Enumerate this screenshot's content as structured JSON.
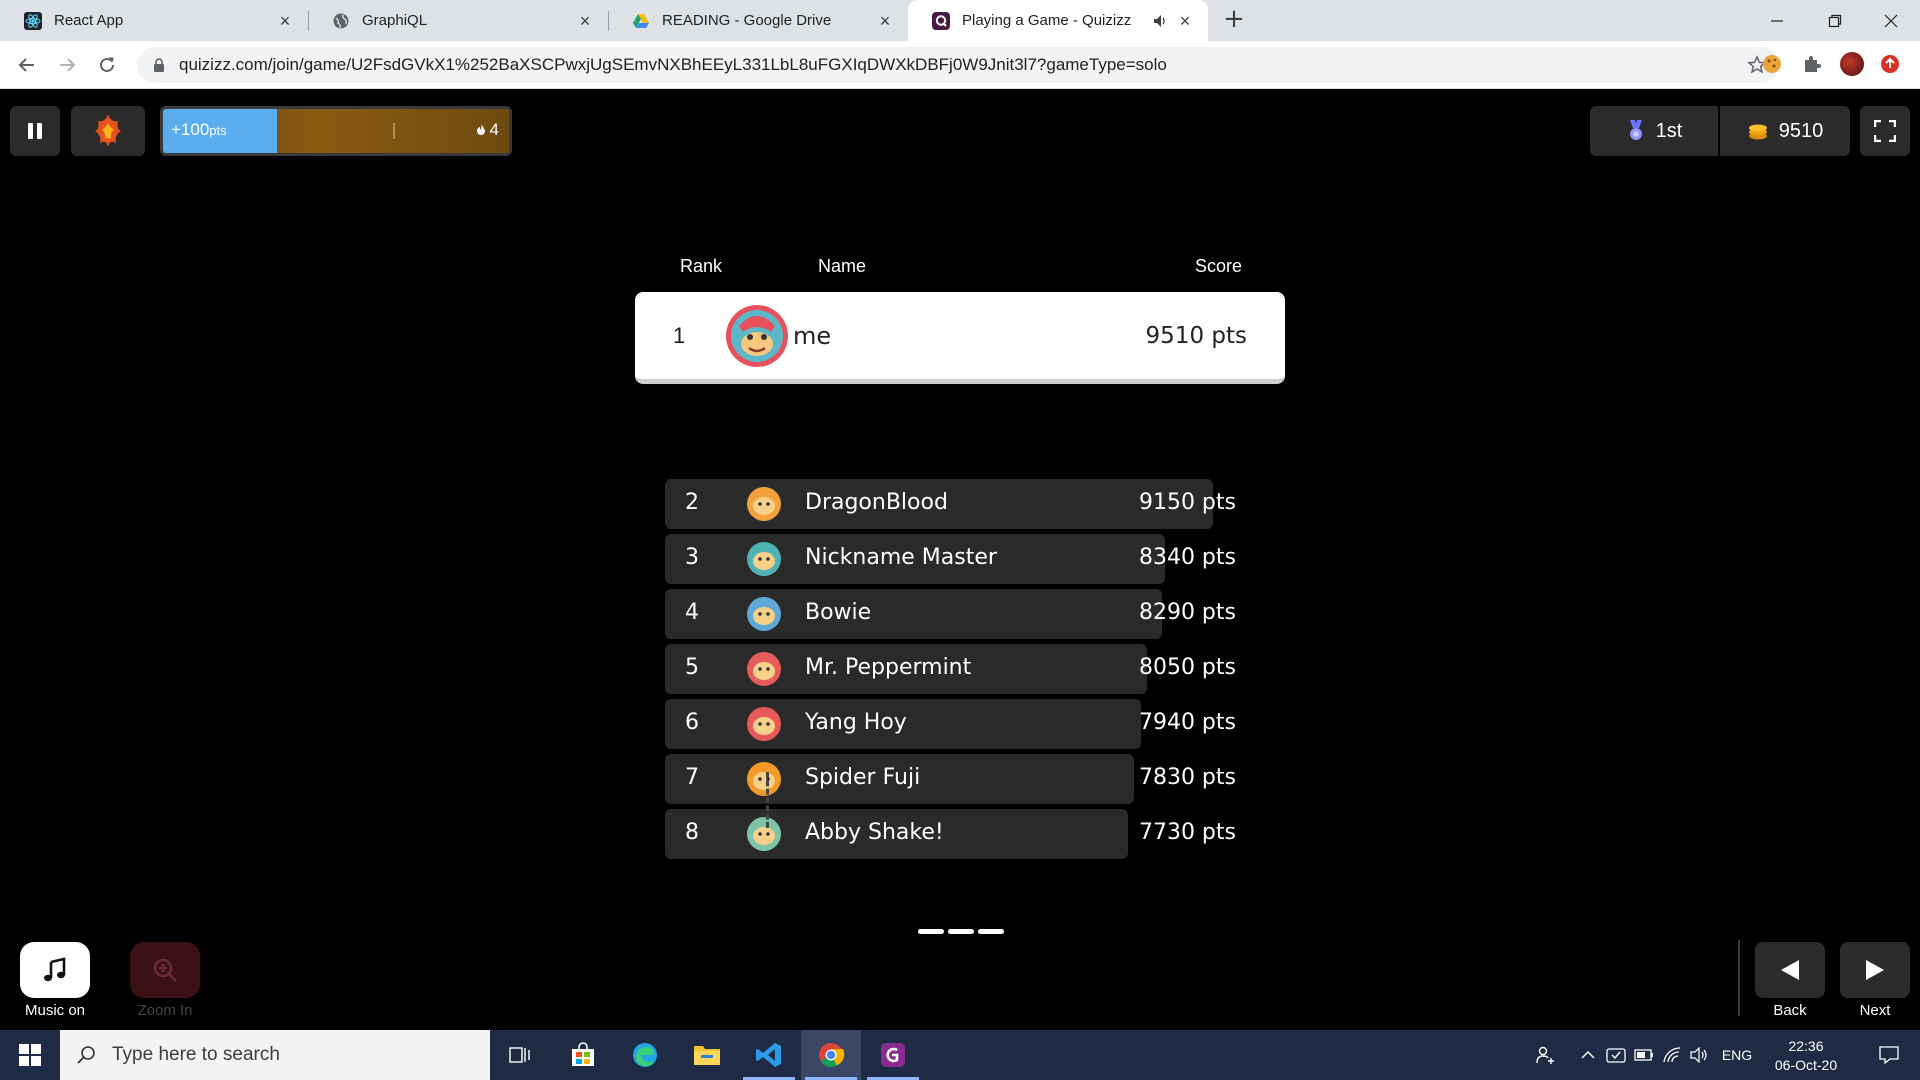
{
  "browser": {
    "tabs": [
      {
        "title": "React App",
        "favicon": "react-icon",
        "active": false
      },
      {
        "title": "GraphiQL",
        "favicon": "globe-icon",
        "active": false
      },
      {
        "title": "READING - Google Drive",
        "favicon": "google-drive-icon",
        "active": false
      },
      {
        "title": "Playing a Game - Quizizz",
        "favicon": "quizizz-icon",
        "active": true,
        "audio": true
      }
    ],
    "url": "quizizz.com/join/game/U2FsdGVkX1%252BaXSCPwxjUgSEmvNXBhEEyL331LbL8uFGXIqDWXkDBFj0W9Jnit3l7?gameType=solo"
  },
  "hud": {
    "streak_points": "+100",
    "streak_points_unit": "pts",
    "streak_progress": 0.33,
    "streak_count": "4",
    "rank": "1st",
    "coins": "9510"
  },
  "leaderboard": {
    "headers": {
      "rank": "Rank",
      "name": "Name",
      "score": "Score"
    },
    "me": {
      "rank": "1",
      "name": "me",
      "score": "9510 pts"
    },
    "others": [
      {
        "rank": "2",
        "name": "DragonBlood",
        "score": "9150 pts",
        "bar": 0.962,
        "avatar_color": "#f2a13b"
      },
      {
        "rank": "3",
        "name": "Nickname Master",
        "score": "8340 pts",
        "bar": 0.877,
        "avatar_color": "#4fb3b5"
      },
      {
        "rank": "4",
        "name": "Bowie",
        "score": "8290 pts",
        "bar": 0.872,
        "avatar_color": "#5fa8d6"
      },
      {
        "rank": "5",
        "name": "Mr. Peppermint",
        "score": "8050 pts",
        "bar": 0.846,
        "avatar_color": "#e65c5c"
      },
      {
        "rank": "6",
        "name": "Yang Hoy",
        "score": "7940 pts",
        "bar": 0.835,
        "avatar_color": "#e85a5a"
      },
      {
        "rank": "7",
        "name": "Spider Fuji",
        "score": "7830 pts",
        "bar": 0.823,
        "avatar_color": "#f39a2b"
      },
      {
        "rank": "8",
        "name": "Abby Shake!",
        "score": "7730 pts",
        "bar": 0.813,
        "avatar_color": "#7cc4a4"
      }
    ]
  },
  "controls": {
    "music_label": "Music on",
    "zoom_label": "Zoom In",
    "back_label": "Back",
    "next_label": "Next"
  },
  "taskbar": {
    "search_placeholder": "Type here to search",
    "language": "ENG",
    "time": "22:36",
    "date": "06-Oct-20"
  },
  "colors": {
    "streak_fill": "#5aaef0",
    "streak_bg": "#8a5a12",
    "row_bg": "#2a2a2a",
    "me_card_bg": "#ffffff",
    "taskbar_bg": "#1f2a44"
  }
}
